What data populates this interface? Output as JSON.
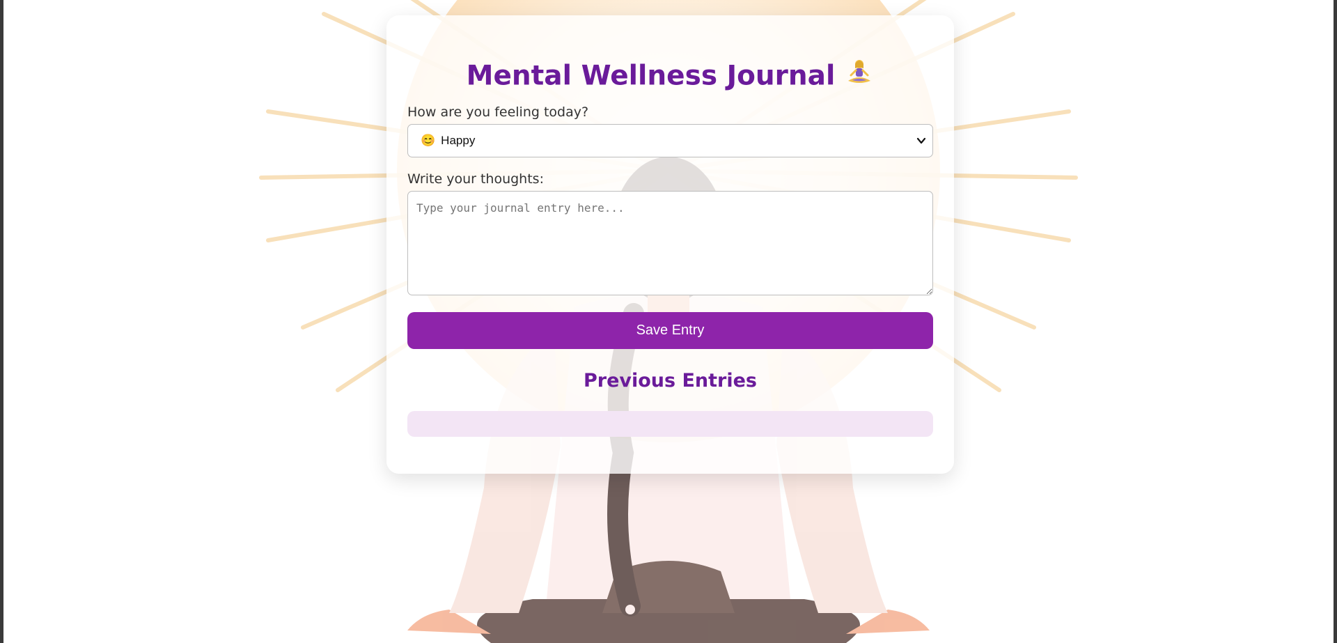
{
  "app": {
    "title": "Mental Wellness Journal",
    "title_icon": "meditating-person-icon"
  },
  "mood": {
    "label": "How are you feeling today?",
    "selected_emoji": "😊",
    "selected_label": "Happy"
  },
  "journal": {
    "label": "Write your thoughts:",
    "placeholder": "Type your journal entry here...",
    "value": ""
  },
  "actions": {
    "save_label": "Save Entry"
  },
  "entries": {
    "heading": "Previous Entries",
    "items": []
  },
  "colors": {
    "accent": "#8e24aa",
    "heading": "#6a1b9a",
    "entries_bg": "#f3e5f5"
  }
}
